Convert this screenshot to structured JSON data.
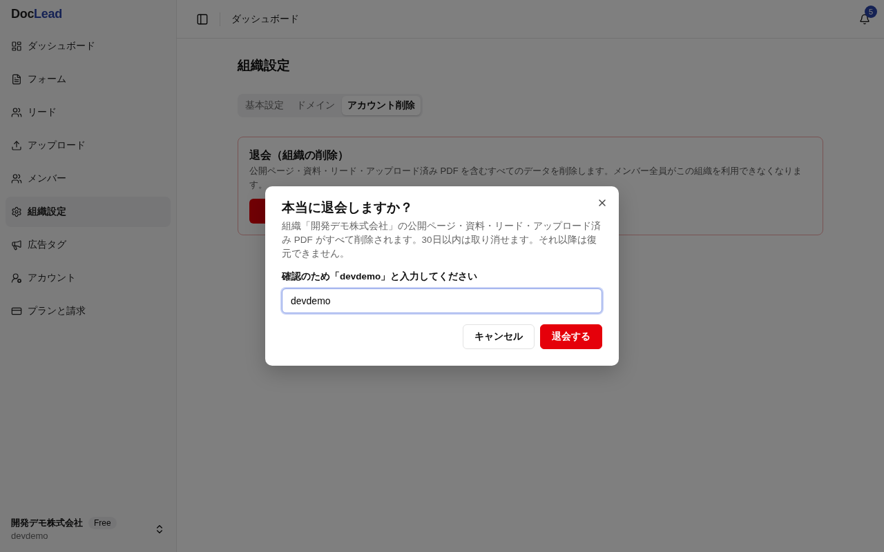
{
  "sidebar": {
    "logo": {
      "part_1": "Doc",
      "part_2": "Lead"
    },
    "items": [
      {
        "label": "ダッシュボード",
        "kind": "dashboard",
        "selected": false
      },
      {
        "label": "フォーム",
        "kind": "form",
        "selected": false
      },
      {
        "label": "リード",
        "kind": "users",
        "selected": false
      },
      {
        "label": "アップロード",
        "kind": "upload",
        "selected": false
      },
      {
        "label": "メンバー",
        "kind": "users",
        "selected": false
      },
      {
        "label": "組織設定",
        "kind": "settings",
        "selected": true
      },
      {
        "label": "広告タグ",
        "kind": "megaphone",
        "selected": false
      },
      {
        "label": "アカウント",
        "kind": "account",
        "selected": false
      },
      {
        "label": "プランと請求",
        "kind": "billing",
        "selected": false
      }
    ],
    "org": {
      "name": "開発デモ株式会社",
      "plan": "Free",
      "slug": "devdemo"
    }
  },
  "header": {
    "breadcrumb": "ダッシュボード",
    "notification_count": "5"
  },
  "page": {
    "title": "組織設定",
    "tabs": [
      {
        "label": "基本設定",
        "selected": false
      },
      {
        "label": "ドメイン",
        "selected": false
      },
      {
        "label": "アカウント削除",
        "selected": true
      }
    ],
    "danger_card": {
      "title": "退会（組織の削除）",
      "description": "公開ページ・資料・リード・アップロード済み PDF を含むすべてのデータを削除します。メンバー全員がこの組織を利用できなくなります。"
    }
  },
  "dialog": {
    "title": "本当に退会しますか？",
    "description": "組織「開発デモ株式会社」の公開ページ・資料・リード・アップロード済み PDF がすべて削除されます。30日以内は取り消せます。それ以降は復元できません。",
    "field_label": "確認のため「devdemo」と入力してください",
    "value": "devdemo",
    "buttons": [
      {
        "label": "キャンセル",
        "kind": "secondary"
      },
      {
        "label": "退会する",
        "kind": "danger"
      }
    ]
  }
}
